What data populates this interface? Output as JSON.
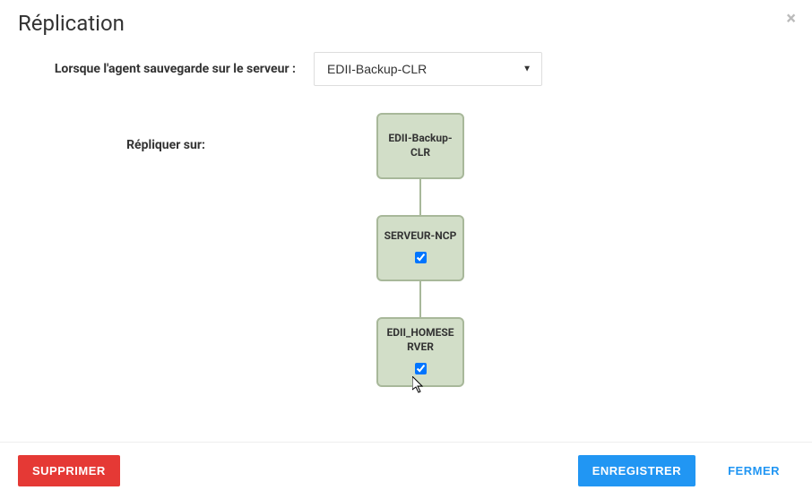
{
  "modal": {
    "title": "Réplication",
    "close_symbol": "×"
  },
  "form": {
    "source_label": "Lorsque l'agent sauvegarde sur le serveur :",
    "source_selected": "EDII-Backup-CLR",
    "replicate_label": "Répliquer sur:"
  },
  "nodes": {
    "root": {
      "label": "EDII-Backup-CLR"
    },
    "child1": {
      "label": "SERVEUR-NCP",
      "checked": true
    },
    "child2": {
      "label": "EDII_HOMESERVER",
      "checked": true
    }
  },
  "footer": {
    "delete": "SUPPRIMER",
    "save": "ENREGISTRER",
    "close": "FERMER"
  }
}
